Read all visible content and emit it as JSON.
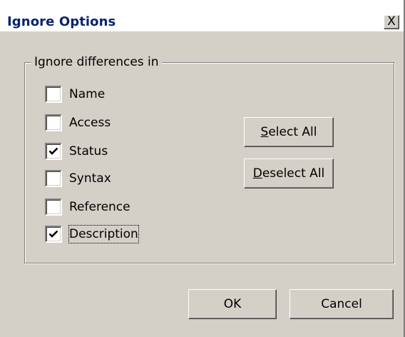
{
  "dialog": {
    "title": "Ignore Options",
    "close_glyph": "X"
  },
  "group": {
    "label": "Ignore differences in",
    "items": [
      {
        "label": "Name",
        "checked": false
      },
      {
        "label": "Access",
        "checked": false
      },
      {
        "label": "Status",
        "checked": true
      },
      {
        "label": "Syntax",
        "checked": false
      },
      {
        "label": "Reference",
        "checked": false
      },
      {
        "label": "Description",
        "checked": true,
        "focused": true
      }
    ]
  },
  "buttons": {
    "select_all": {
      "mnemonic": "S",
      "rest": "elect All"
    },
    "deselect_all": {
      "mnemonic": "D",
      "rest": "eselect All"
    },
    "ok": "OK",
    "cancel": "Cancel"
  },
  "colors": {
    "face": "#d4d0c8",
    "title_text": "#0a246a"
  }
}
